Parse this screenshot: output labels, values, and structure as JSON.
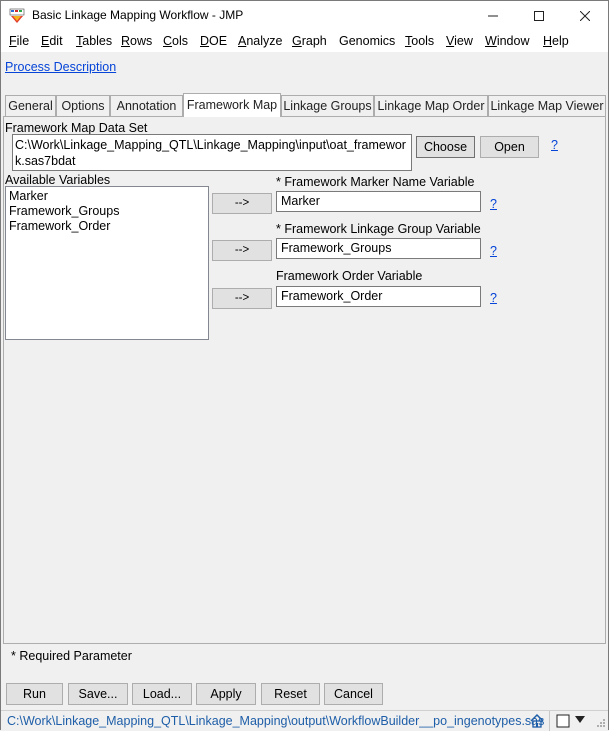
{
  "window": {
    "title": "Basic Linkage Mapping Workflow - JMP",
    "minimize_glyph": "–",
    "maximize_glyph": "□",
    "close_glyph": "✕"
  },
  "menu": [
    {
      "label": "File",
      "accel": "F",
      "rest": "ile"
    },
    {
      "label": "Edit",
      "accel": "E",
      "rest": "dit"
    },
    {
      "label": "Tables",
      "accel": "T",
      "rest": "ables"
    },
    {
      "label": "Rows",
      "accel": "R",
      "rest": "ows"
    },
    {
      "label": "Cols",
      "accel": "C",
      "rest": "ols"
    },
    {
      "label": "DOE",
      "accel": "D",
      "rest": "OE"
    },
    {
      "label": "Analyze",
      "accel": "A",
      "rest": "nalyze"
    },
    {
      "label": "Graph",
      "accel": "G",
      "rest": "raph"
    },
    {
      "label": "Genomics",
      "accel": "",
      "rest": "Genomics"
    },
    {
      "label": "Tools",
      "accel": "T",
      "rest": "ools"
    },
    {
      "label": "View",
      "accel": "V",
      "rest": "iew"
    },
    {
      "label": "Window",
      "accel": "W",
      "rest": "indow"
    },
    {
      "label": "Help",
      "accel": "H",
      "rest": "elp"
    }
  ],
  "process_description_link": "Process Description",
  "tabs": [
    {
      "label": "General"
    },
    {
      "label": "Options"
    },
    {
      "label": "Annotation"
    },
    {
      "label": "Framework Map"
    },
    {
      "label": "Linkage Groups"
    },
    {
      "label": "Linkage Map Order"
    },
    {
      "label": "Linkage Map Viewer"
    }
  ],
  "active_tab": "Framework Map",
  "data_set": {
    "label": "Framework Map Data Set",
    "path": "C:\\Work\\Linkage_Mapping_QTL\\Linkage_Mapping\\input\\oat_framework.sas7bdat",
    "choose_label": "Choose",
    "open_label": "Open",
    "help_label": "?"
  },
  "available_variables": {
    "label": "Available Variables",
    "items": [
      "Marker",
      "Framework_Groups",
      "Framework_Order"
    ]
  },
  "roles": [
    {
      "label": "* Framework Marker Name Variable",
      "value": "Marker",
      "arrow": "-->",
      "help": "?"
    },
    {
      "label": "* Framework Linkage Group Variable",
      "value": "Framework_Groups",
      "arrow": "-->",
      "help": "?"
    },
    {
      "label": "Framework Order Variable",
      "value": "Framework_Order",
      "arrow": "-->",
      "help": "?"
    }
  ],
  "required_note": "* Required Parameter",
  "buttons": {
    "run": "Run",
    "save": "Save...",
    "load": "Load...",
    "apply": "Apply",
    "reset": "Reset",
    "cancel": "Cancel"
  },
  "status": {
    "path": "C:\\Work\\Linkage_Mapping_QTL\\Linkage_Mapping\\output\\WorkflowBuilder__po_ingenotypes.sas"
  },
  "colors": {
    "link": "#0645d8",
    "status_text": "#1e5ea8"
  }
}
